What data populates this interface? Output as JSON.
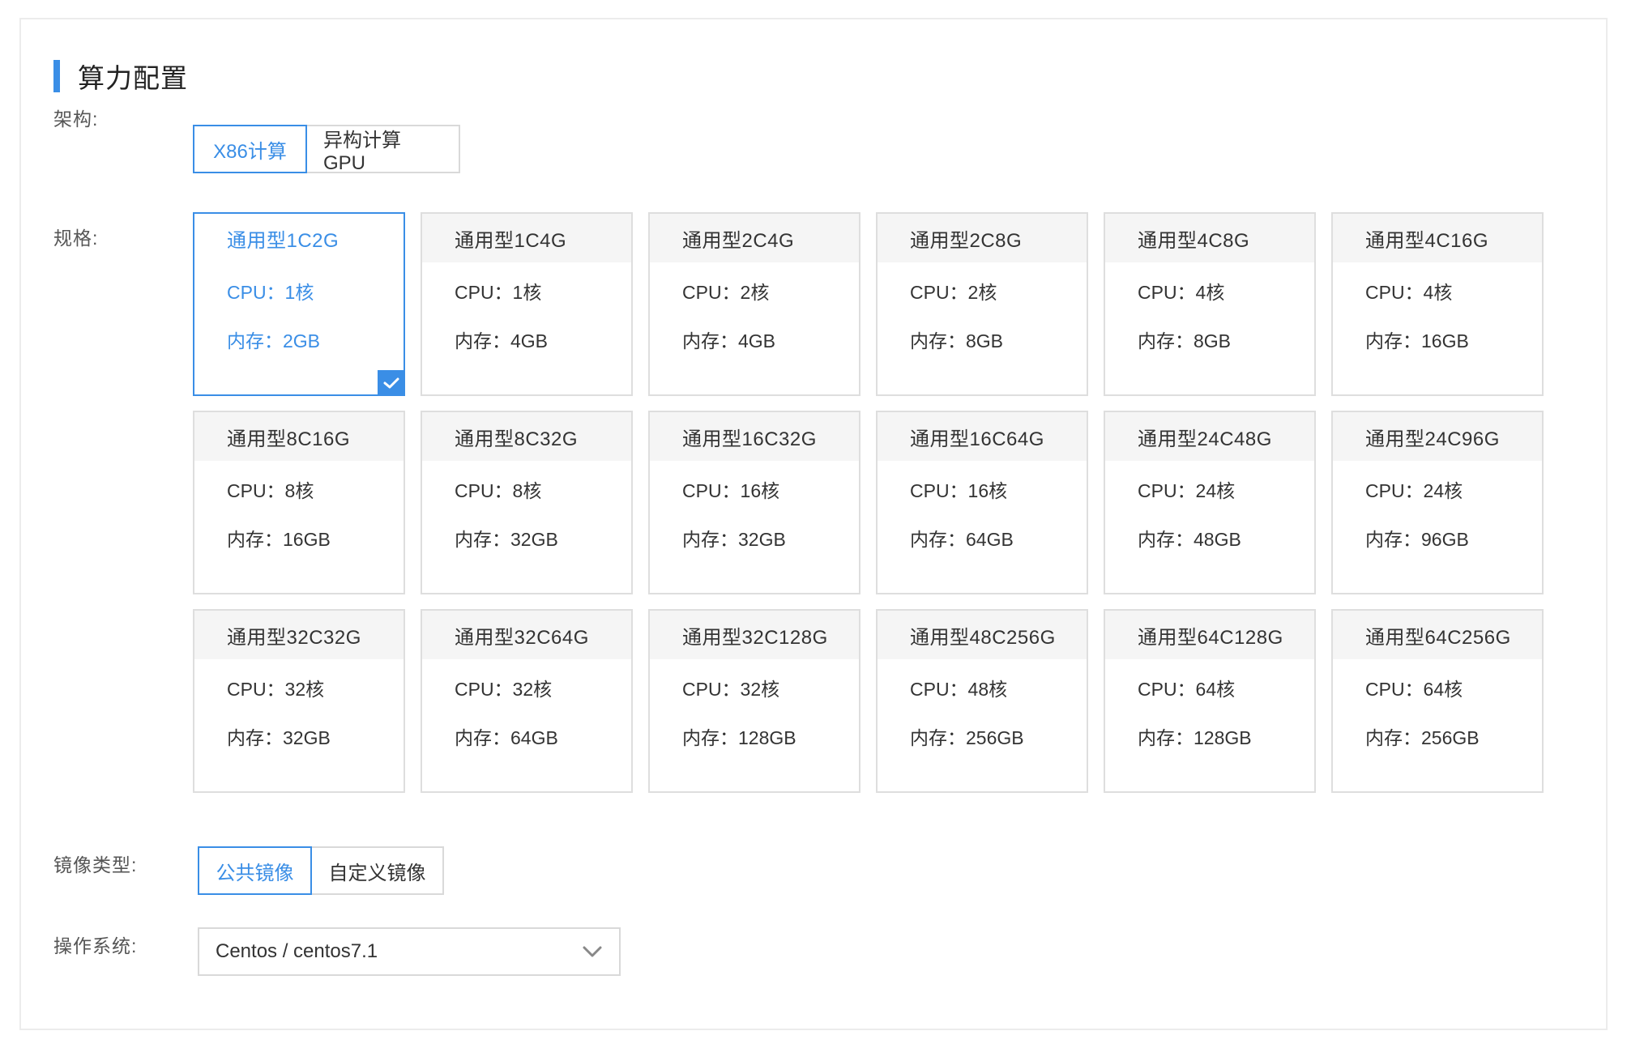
{
  "section": {
    "title": "算力配置"
  },
  "architecture": {
    "label": "架构:",
    "options": [
      "X86计算",
      "异构计算GPU"
    ],
    "selected": "X86计算"
  },
  "spec": {
    "label": "规格:",
    "selected": "通用型1C2G",
    "cards": [
      {
        "name": "通用型1C2G",
        "cpu": "CPU：1核",
        "mem": "内存：2GB"
      },
      {
        "name": "通用型1C4G",
        "cpu": "CPU：1核",
        "mem": "内存：4GB"
      },
      {
        "name": "通用型2C4G",
        "cpu": "CPU：2核",
        "mem": "内存：4GB"
      },
      {
        "name": "通用型2C8G",
        "cpu": "CPU：2核",
        "mem": "内存：8GB"
      },
      {
        "name": "通用型4C8G",
        "cpu": "CPU：4核",
        "mem": "内存：8GB"
      },
      {
        "name": "通用型4C16G",
        "cpu": "CPU：4核",
        "mem": "内存：16GB"
      },
      {
        "name": "通用型8C16G",
        "cpu": "CPU：8核",
        "mem": "内存：16GB"
      },
      {
        "name": "通用型8C32G",
        "cpu": "CPU：8核",
        "mem": "内存：32GB"
      },
      {
        "name": "通用型16C32G",
        "cpu": "CPU：16核",
        "mem": "内存：32GB"
      },
      {
        "name": "通用型16C64G",
        "cpu": "CPU：16核",
        "mem": "内存：64GB"
      },
      {
        "name": "通用型24C48G",
        "cpu": "CPU：24核",
        "mem": "内存：48GB"
      },
      {
        "name": "通用型24C96G",
        "cpu": "CPU：24核",
        "mem": "内存：96GB"
      },
      {
        "name": "通用型32C32G",
        "cpu": "CPU：32核",
        "mem": "内存：32GB"
      },
      {
        "name": "通用型32C64G",
        "cpu": "CPU：32核",
        "mem": "内存：64GB"
      },
      {
        "name": "通用型32C128G",
        "cpu": "CPU：32核",
        "mem": "内存：128GB"
      },
      {
        "name": "通用型48C256G",
        "cpu": "CPU：48核",
        "mem": "内存：256GB"
      },
      {
        "name": "通用型64C128G",
        "cpu": "CPU：64核",
        "mem": "内存：128GB"
      },
      {
        "name": "通用型64C256G",
        "cpu": "CPU：64核",
        "mem": "内存：256GB"
      }
    ]
  },
  "image_type": {
    "label": "镜像类型:",
    "options": [
      "公共镜像",
      "自定义镜像"
    ],
    "selected": "公共镜像"
  },
  "os": {
    "label": "操作系统:",
    "value": "Centos / centos7.1"
  },
  "icons": {
    "check": "checkmark-icon",
    "dropdown": "chevron-down-icon"
  },
  "colors": {
    "accent": "#3a8ee6",
    "card_header_bg": "#f5f5f5",
    "border": "#dedede"
  }
}
